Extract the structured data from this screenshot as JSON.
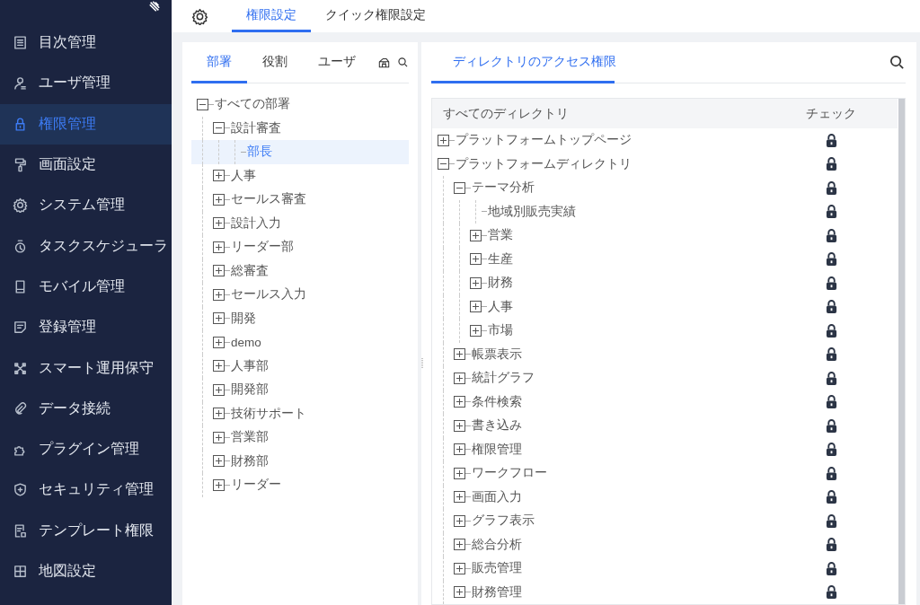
{
  "sidebar": {
    "items": [
      {
        "label": "目次管理",
        "selected": false
      },
      {
        "label": "ユーザ管理",
        "selected": false
      },
      {
        "label": "権限管理",
        "selected": true
      },
      {
        "label": "画面設定",
        "selected": false
      },
      {
        "label": "システム管理",
        "selected": false
      },
      {
        "label": "タスクスケジューラ",
        "selected": false
      },
      {
        "label": "モバイル管理",
        "selected": false
      },
      {
        "label": "登録管理",
        "selected": false
      },
      {
        "label": "スマート運用保守",
        "selected": false
      },
      {
        "label": "データ接続",
        "selected": false
      },
      {
        "label": "プラグイン管理",
        "selected": false
      },
      {
        "label": "セキュリティ管理",
        "selected": false
      },
      {
        "label": "テンプレート権限",
        "selected": false
      },
      {
        "label": "地図設定",
        "selected": false
      }
    ]
  },
  "top_tabs": [
    {
      "label": "権限設定",
      "selected": true
    },
    {
      "label": "クイック権限設定",
      "selected": false
    }
  ],
  "left_panel": {
    "tabs": [
      {
        "label": "部署",
        "selected": true
      },
      {
        "label": "役割",
        "selected": false
      },
      {
        "label": "ユーザ",
        "selected": false
      }
    ],
    "tree": [
      {
        "label": "すべての部署",
        "expanded": true,
        "selected": false,
        "children": [
          {
            "label": "設計審査",
            "expanded": true,
            "selected": false,
            "children": [
              {
                "label": "部長",
                "selected": true
              }
            ]
          },
          {
            "label": "人事",
            "expanded": false,
            "selected": false
          },
          {
            "label": "セールス審査",
            "expanded": false,
            "selected": false
          },
          {
            "label": "設計入力",
            "expanded": false,
            "selected": false
          },
          {
            "label": "リーダー部",
            "expanded": false,
            "selected": false
          },
          {
            "label": "総審査",
            "expanded": false,
            "selected": false
          },
          {
            "label": "セールス入力",
            "expanded": false,
            "selected": false
          },
          {
            "label": "開発",
            "expanded": false,
            "selected": false
          },
          {
            "label": "demo",
            "expanded": false,
            "selected": false
          },
          {
            "label": "人事部",
            "expanded": false,
            "selected": false
          },
          {
            "label": "開発部",
            "expanded": false,
            "selected": false
          },
          {
            "label": "技術サポート",
            "expanded": false,
            "selected": false
          },
          {
            "label": "営業部",
            "expanded": false,
            "selected": false
          },
          {
            "label": "財務部",
            "expanded": false,
            "selected": false
          },
          {
            "label": "リーダー",
            "expanded": false,
            "selected": false
          }
        ]
      }
    ]
  },
  "right_panel": {
    "tabs": [
      {
        "label": "ディレクトリのアクセス権限",
        "selected": true
      }
    ],
    "columns": [
      "すべてのディレクトリ",
      "チェック"
    ],
    "tree": [
      {
        "label": "プラットフォームトップページ",
        "expanded": false
      },
      {
        "label": "プラットフォームディレクトリ",
        "expanded": true,
        "children": [
          {
            "label": "テーマ分析",
            "expanded": true,
            "children": [
              {
                "label": "地域別販売実績"
              },
              {
                "label": "営業",
                "expanded": false
              },
              {
                "label": "生産",
                "expanded": false
              },
              {
                "label": "財務",
                "expanded": false
              },
              {
                "label": "人事",
                "expanded": false
              },
              {
                "label": "市場",
                "expanded": false
              }
            ]
          },
          {
            "label": "帳票表示",
            "expanded": false
          },
          {
            "label": "統計グラフ",
            "expanded": false
          },
          {
            "label": "条件検索",
            "expanded": false
          },
          {
            "label": "書き込み",
            "expanded": false
          },
          {
            "label": "権限管理",
            "expanded": false
          },
          {
            "label": "ワークフロー",
            "expanded": false
          },
          {
            "label": "画面入力",
            "expanded": false
          },
          {
            "label": "グラフ表示",
            "expanded": false
          },
          {
            "label": "総合分析",
            "expanded": false
          },
          {
            "label": "販売管理",
            "expanded": false
          },
          {
            "label": "財務管理",
            "expanded": false
          }
        ]
      }
    ]
  }
}
